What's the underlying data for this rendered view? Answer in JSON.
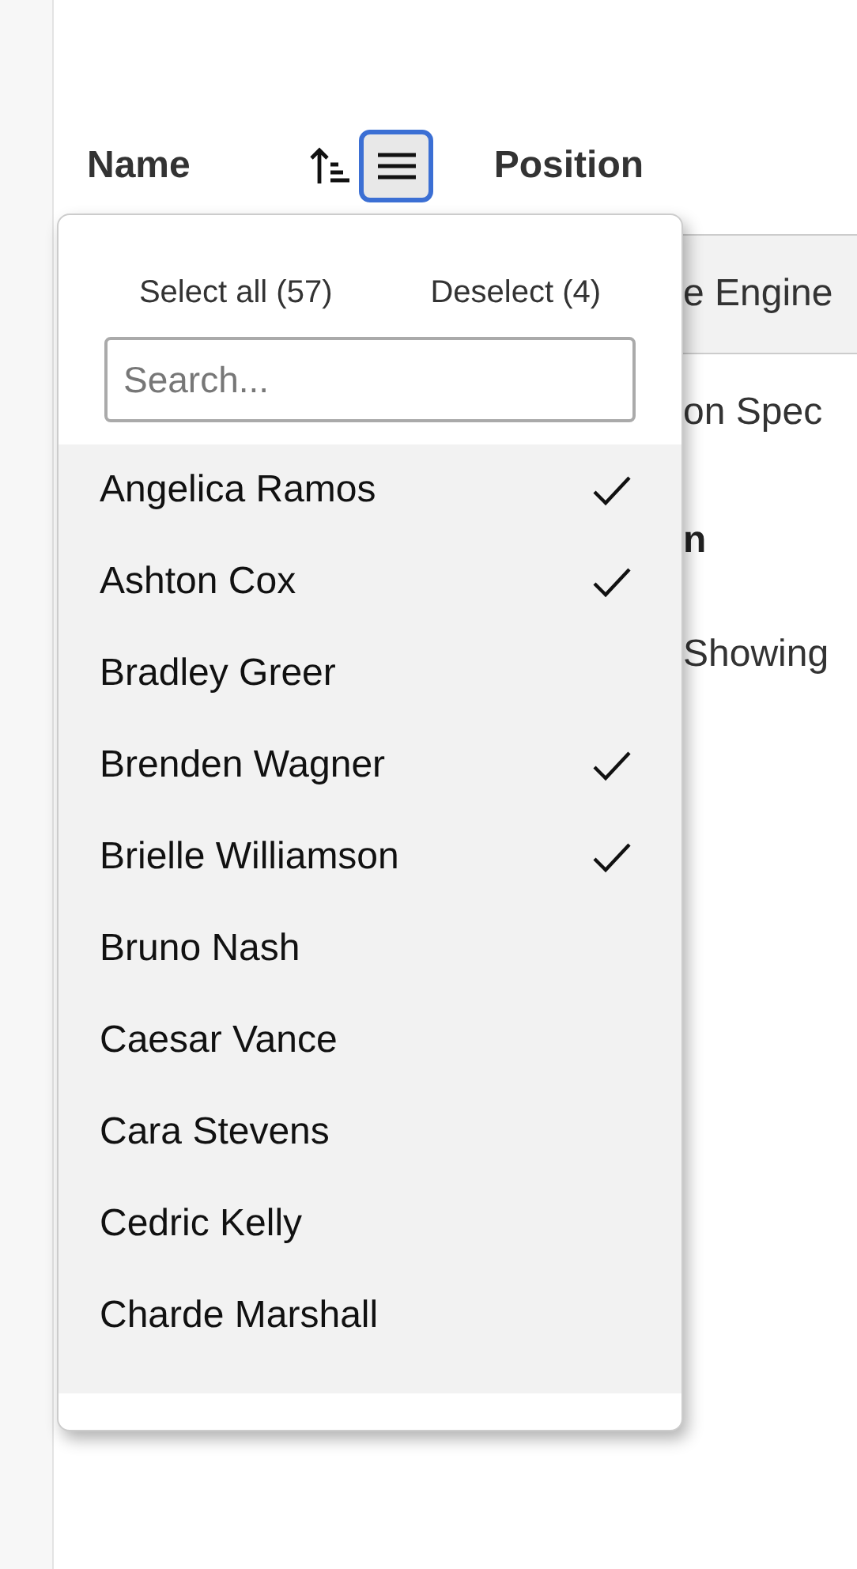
{
  "columns": [
    {
      "label": "Name"
    },
    {
      "label": "Position"
    }
  ],
  "table": {
    "rows": [
      {
        "column_2": "e Engine"
      },
      {
        "column_2": "on Spec"
      }
    ],
    "footer": "n",
    "info": "Showing"
  },
  "filter_menu": {
    "select_all": "Select all (57)",
    "deselect": "Deselect (4)",
    "search": {
      "placeholder": "Search..."
    },
    "options": [
      {
        "label": "Angelica Ramos",
        "checked": true
      },
      {
        "label": "Ashton Cox",
        "checked": true
      },
      {
        "label": "Bradley Greer",
        "checked": false
      },
      {
        "label": "Brenden Wagner",
        "checked": true
      },
      {
        "label": "Brielle Williamson",
        "checked": true
      },
      {
        "label": "Bruno Nash",
        "checked": false
      },
      {
        "label": "Caesar Vance",
        "checked": false
      },
      {
        "label": "Cara Stevens",
        "checked": false
      },
      {
        "label": "Cedric Kelly",
        "checked": false
      },
      {
        "label": "Charde Marshall",
        "checked": false
      }
    ]
  }
}
